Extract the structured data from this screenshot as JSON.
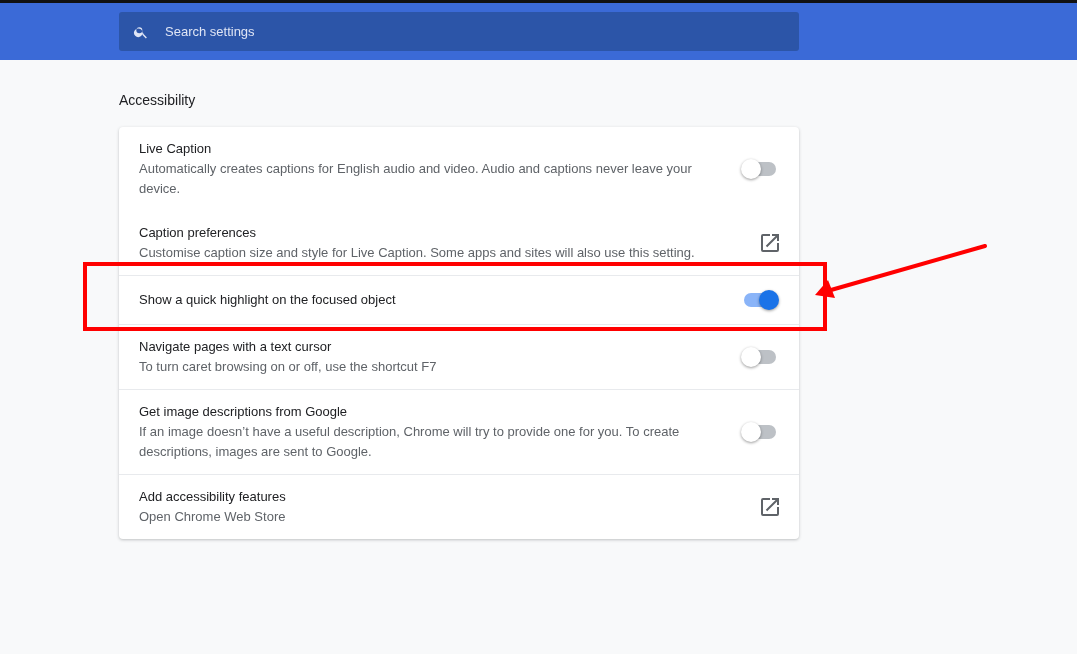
{
  "search": {
    "placeholder": "Search settings"
  },
  "section_title": "Accessibility",
  "rows": [
    {
      "kind": "toggle",
      "title": "Live Caption",
      "description": "Automatically creates captions for English audio and video. Audio and captions never leave your device.",
      "on": false,
      "highlighted": false,
      "divider": false
    },
    {
      "kind": "link",
      "title": "Caption preferences",
      "description": "Customise caption size and style for Live Caption. Some apps and sites will also use this setting.",
      "highlighted": false,
      "divider": false
    },
    {
      "kind": "toggle",
      "title": "Show a quick highlight on the focused object",
      "on": true,
      "highlighted": true,
      "divider": true
    },
    {
      "kind": "toggle",
      "title": "Navigate pages with a text cursor",
      "description": "To turn caret browsing on or off, use the shortcut F7",
      "on": false,
      "highlighted": false,
      "divider": true
    },
    {
      "kind": "toggle",
      "title": "Get image descriptions from Google",
      "description": "If an image doesn’t have a useful description, Chrome will try to provide one for you. To create descriptions, images are sent to Google.",
      "on": false,
      "highlighted": false,
      "divider": true
    },
    {
      "kind": "link",
      "title": "Add accessibility features",
      "description": "Open Chrome Web Store",
      "highlighted": false,
      "divider": true
    }
  ]
}
